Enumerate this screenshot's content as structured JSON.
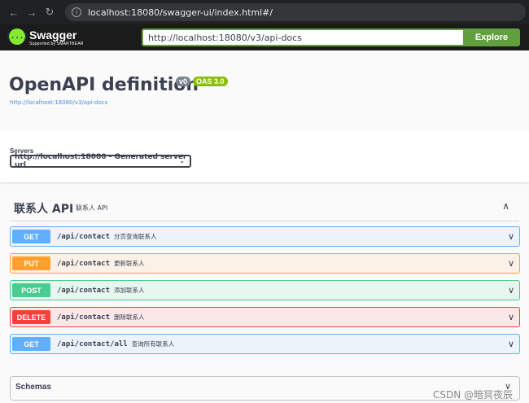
{
  "browser": {
    "back_icon": "←",
    "forward_icon": "→",
    "reload_icon": "↻",
    "url": "localhost:18080/swagger-ui/index.html#/"
  },
  "topbar": {
    "logo_icon": "{...}",
    "logo_name": "Swagger",
    "logo_sub": "Supported by SMARTBEAR",
    "spec_url": "http://localhost:18080/v3/api-docs",
    "explore_label": "Explore"
  },
  "info": {
    "title": "OpenAPI definition",
    "version": "v0",
    "oas": "OAS 3.0",
    "docs_link": "http://localhost:18080/v3/api-docs"
  },
  "servers": {
    "label": "Servers",
    "selected": "http://localhost:18080 - Generated server url"
  },
  "tag": {
    "name": "联系人 API",
    "description": "联系人 API"
  },
  "operations": [
    {
      "method": "GET",
      "path": "/api/contact",
      "summary": "分页查询联系人"
    },
    {
      "method": "PUT",
      "path": "/api/contact",
      "summary": "更新联系人"
    },
    {
      "method": "POST",
      "path": "/api/contact",
      "summary": "添加联系人"
    },
    {
      "method": "DELETE",
      "path": "/api/contact",
      "summary": "删除联系人"
    },
    {
      "method": "GET",
      "path": "/api/contact/all",
      "summary": "查询所有联系人"
    }
  ],
  "schemas": {
    "title": "Schemas"
  },
  "icons": {
    "chevron_up": "∧",
    "chevron_down": "∨",
    "select_chevron": "⌄"
  },
  "watermark": "CSDN @暗冥夜辰"
}
